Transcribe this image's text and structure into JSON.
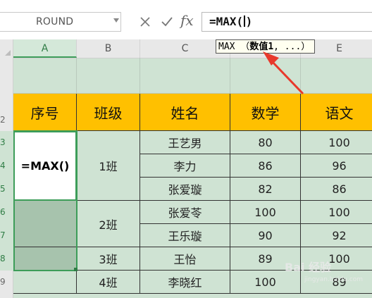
{
  "name_box": {
    "value": "ROUND"
  },
  "formula_bar": {
    "formula_before": "=MAX(",
    "formula_after": ")"
  },
  "tooltip": {
    "prefix": "MAX （",
    "arg": "数值1",
    "suffix": ", ...）"
  },
  "columns": [
    "A",
    "B",
    "C",
    "D",
    "E"
  ],
  "row_numbers": [
    "2",
    "3",
    "4",
    "5",
    "6",
    "7",
    "8",
    "9"
  ],
  "table": {
    "headers": [
      "序号",
      "班级",
      "姓名",
      "数学",
      "语文"
    ],
    "formula_cell": "=MAX()",
    "classes": [
      "1班",
      "2班",
      "3班",
      "4班"
    ],
    "names": [
      "王艺男",
      "李力",
      "张爱璇",
      "张爱苓",
      "王乐璇",
      "王怡",
      "李晓红"
    ],
    "math": [
      "80",
      "86",
      "82",
      "100",
      "90",
      "89",
      "100"
    ],
    "chinese": [
      "100",
      "96",
      "86",
      "100",
      "92",
      "100",
      "89"
    ]
  },
  "watermark": {
    "text": "Bai 经验",
    "sub": "jingyan.baidu.com"
  },
  "colors": {
    "header_fill": "#ffc000",
    "sheet_bg": "#cfe3d3",
    "selection": "#3d9d59",
    "arrow": "#e8392c"
  }
}
